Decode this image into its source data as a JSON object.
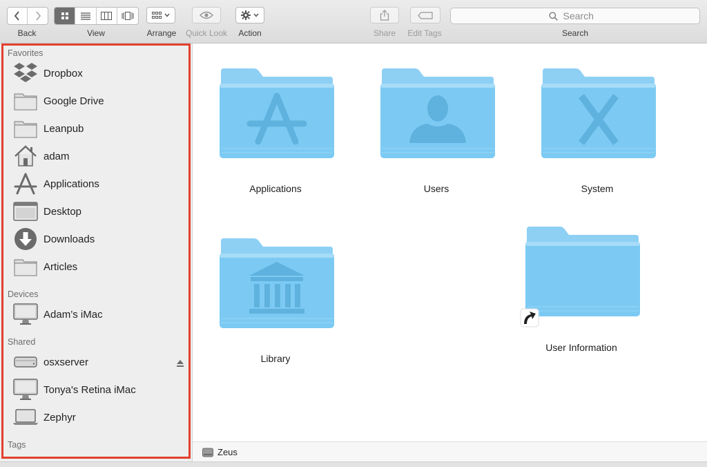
{
  "toolbar": {
    "back_label": "Back",
    "view_label": "View",
    "arrange_label": "Arrange",
    "quick_look_label": "Quick Look",
    "action_label": "Action",
    "share_label": "Share",
    "edit_tags_label": "Edit Tags",
    "search_label": "Search",
    "search_placeholder": "Search",
    "view_mode_selected": "icons"
  },
  "sidebar": {
    "favorites_heading": "Favorites",
    "favorites": [
      {
        "label": "Dropbox",
        "icon": "dropbox-icon"
      },
      {
        "label": "Google Drive",
        "icon": "folder-icon"
      },
      {
        "label": "Leanpub",
        "icon": "folder-icon"
      },
      {
        "label": "adam",
        "icon": "home-icon"
      },
      {
        "label": "Applications",
        "icon": "applications-icon"
      },
      {
        "label": "Desktop",
        "icon": "desktop-icon"
      },
      {
        "label": "Downloads",
        "icon": "downloads-icon"
      },
      {
        "label": "Articles",
        "icon": "folder-icon"
      }
    ],
    "devices_heading": "Devices",
    "devices": [
      {
        "label": "Adam’s iMac",
        "icon": "imac-icon"
      }
    ],
    "shared_heading": "Shared",
    "shared": [
      {
        "label": "osxserver",
        "icon": "server-icon",
        "ejectable": true
      },
      {
        "label": "Tonya's Retina iMac",
        "icon": "imac-icon"
      },
      {
        "label": "Zephyr",
        "icon": "laptop-icon"
      }
    ],
    "tags_heading": "Tags",
    "highlight_color": "#e2402f"
  },
  "main": {
    "folders": [
      {
        "label": "Applications",
        "glyph": "app-store-glyph"
      },
      {
        "label": "Users",
        "glyph": "user-silhouette-glyph"
      },
      {
        "label": "System",
        "glyph": "x-glyph"
      },
      {
        "label": "Library",
        "glyph": "library-columns-glyph"
      },
      {
        "label": "User Information",
        "glyph": "alias-arrow",
        "alias": true
      }
    ],
    "folder_color": "#7ccaf3"
  },
  "pathbar": {
    "volume_label": "Zeus",
    "icon": "hard-drive-icon"
  }
}
